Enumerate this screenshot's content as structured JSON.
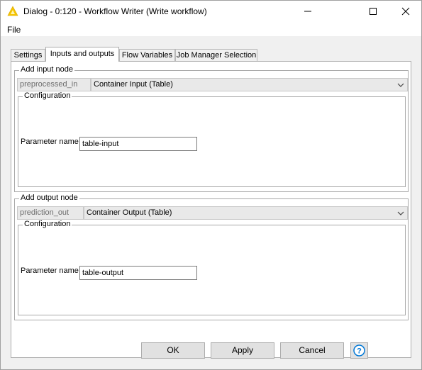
{
  "window": {
    "title": "Dialog - 0:120 - Workflow Writer (Write workflow)"
  },
  "menu": {
    "file": "File"
  },
  "tabs": [
    {
      "label": "Settings"
    },
    {
      "label": "Inputs and outputs"
    },
    {
      "label": "Flow Variables"
    },
    {
      "label": "Job Manager Selection"
    }
  ],
  "input_node": {
    "legend": "Add input node",
    "port": "preprocessed_in",
    "node_type": "Container Input (Table)",
    "config_legend": "Configuration",
    "param_label": "Parameter name",
    "param_value": "table-input"
  },
  "output_node": {
    "legend": "Add output node",
    "port": "prediction_out",
    "node_type": "Container Output (Table)",
    "config_legend": "Configuration",
    "param_label": "Parameter name",
    "param_value": "table-output"
  },
  "buttons": {
    "ok": "OK",
    "apply": "Apply",
    "cancel": "Cancel"
  },
  "colors": {
    "accent": "#0078d7",
    "knime_icon": "#f5c400"
  }
}
